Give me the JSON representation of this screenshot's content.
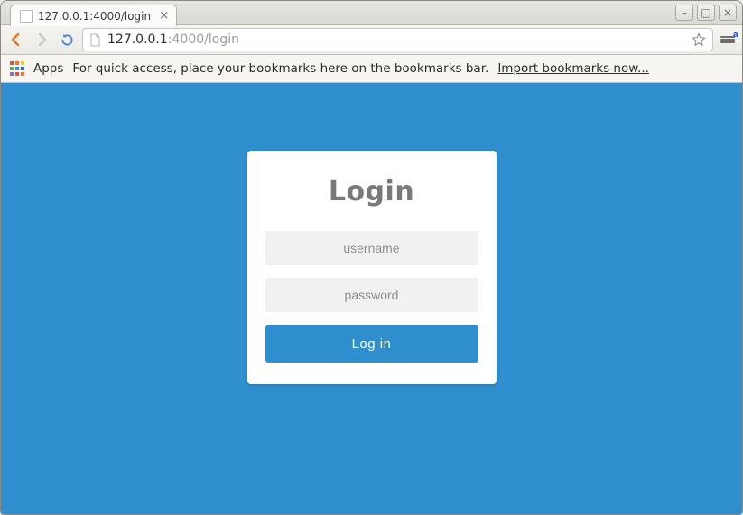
{
  "window": {
    "controls": {
      "minimize": "–",
      "maximize": "□",
      "close": "×"
    }
  },
  "tab": {
    "title": "127.0.0.1:4000/login",
    "close": "×"
  },
  "address": {
    "host": "127.0.0.1",
    "rest": ":4000/login"
  },
  "menu": {
    "badge": "a"
  },
  "bookmarksbar": {
    "apps_label": "Apps",
    "hint": "For quick access, place your bookmarks here on the bookmarks bar.",
    "import_link": "Import bookmarks now..."
  },
  "login": {
    "title": "Login",
    "username_placeholder": "username",
    "password_placeholder": "password",
    "submit_label": "Log in"
  },
  "colors": {
    "page_bg": "#2f8ecd",
    "button_bg": "#2f8ecd",
    "input_bg": "#f1f1f1",
    "title_color": "#797979"
  }
}
